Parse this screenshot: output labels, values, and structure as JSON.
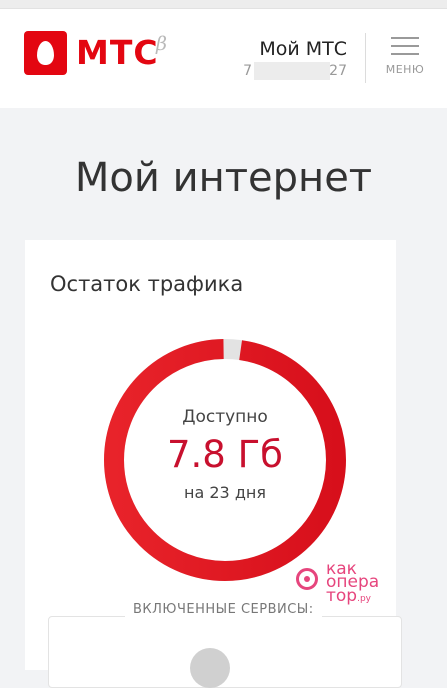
{
  "header": {
    "brand": "МТС",
    "beta": "β",
    "account_title": "Мой МТС",
    "phone_start": "7",
    "phone_end": "27",
    "menu_label": "МЕНЮ"
  },
  "page": {
    "title": "Мой интернет"
  },
  "traffic_card": {
    "title": "Остаток трафика",
    "available_label": "Доступно",
    "amount": "7.8 Гб",
    "period": "на 23 дня",
    "remaining_fraction": 0.98,
    "colors": {
      "ring_start": "#e8232a",
      "ring_end": "#d70f1b",
      "ring_empty": "#e3e3e3"
    }
  },
  "services": {
    "label": "ВКЛЮЧЕННЫЕ СЕРВИСЫ:"
  },
  "watermark": {
    "line1": "как",
    "line2": "опера",
    "line3": "тор",
    "suffix": ".ру"
  },
  "colors": {
    "brand_red": "#e30611",
    "value_red": "#c8102e",
    "watermark_pink": "#e6457d"
  }
}
